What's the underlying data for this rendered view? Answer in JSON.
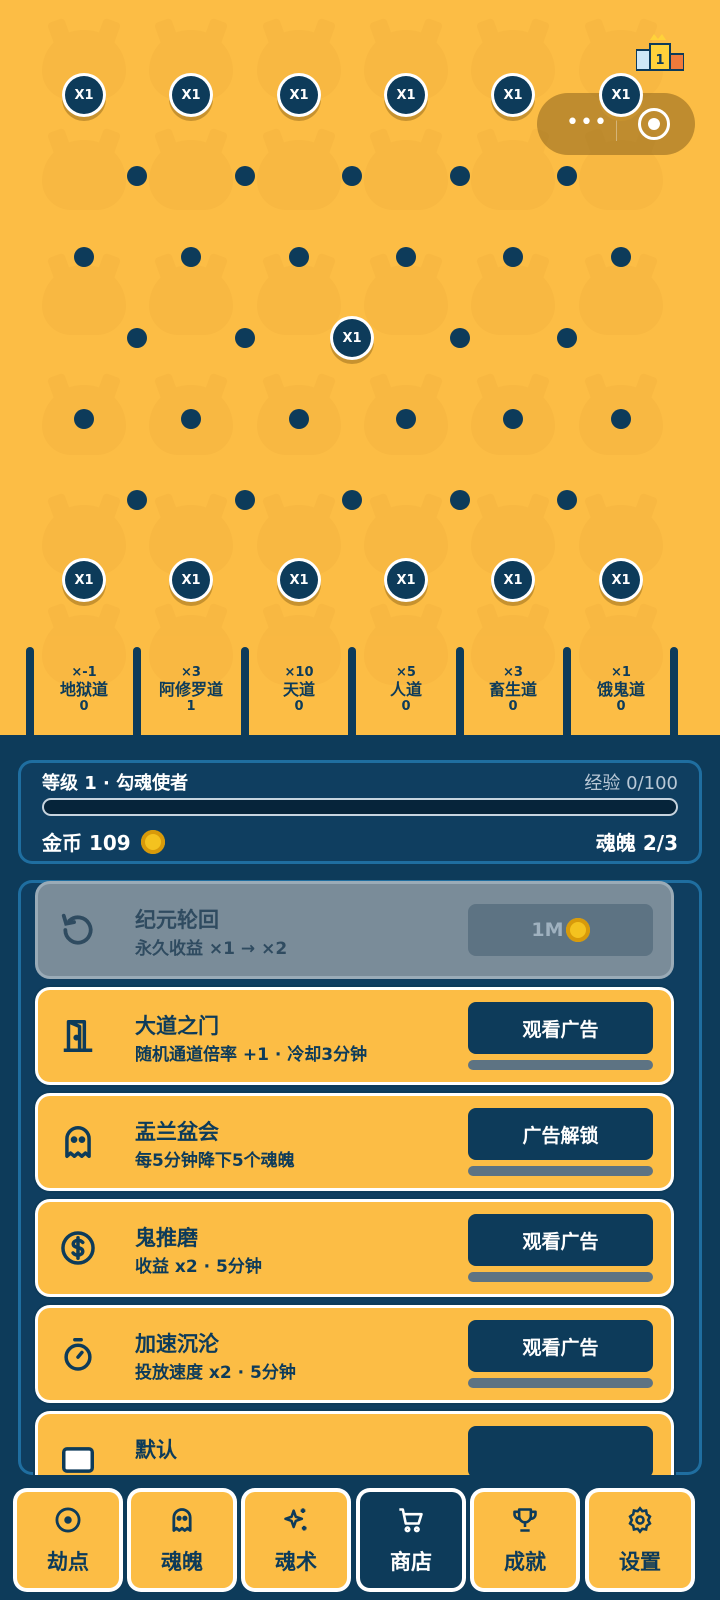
{
  "board": {
    "multiplier_label": "X1",
    "slots": [
      {
        "mult": "×-1",
        "name": "地狱道",
        "count": "0"
      },
      {
        "mult": "×3",
        "name": "阿修罗道",
        "count": "1"
      },
      {
        "mult": "×10",
        "name": "天道",
        "count": "0"
      },
      {
        "mult": "×5",
        "name": "人道",
        "count": "0"
      },
      {
        "mult": "×3",
        "name": "畜生道",
        "count": "0"
      },
      {
        "mult": "×1",
        "name": "饿鬼道",
        "count": "0"
      }
    ],
    "trophy_rank": "1"
  },
  "mini_capsule": {
    "more_glyph": "•••"
  },
  "status": {
    "level": "等级 1 · 勾魂使者",
    "exp": "经验 0/100",
    "exp_fraction": 0,
    "gold_label": "金币 109",
    "souls_label": "魂魄 2/3"
  },
  "shop": {
    "items": [
      {
        "title": "纪元轮回",
        "desc": "永久收益 ×1 → ×2",
        "button": "1M",
        "icon": "rotate-icon",
        "disabled": true
      },
      {
        "title": "大道之门",
        "desc": "随机通道倍率 +1 · 冷却3分钟",
        "button": "观看广告",
        "icon": "door-icon",
        "progress": 0
      },
      {
        "title": "盂兰盆会",
        "desc": "每5分钟降下5个魂魄",
        "button": "广告解锁",
        "icon": "ghost-icon",
        "progress": 0
      },
      {
        "title": "鬼推磨",
        "desc": "收益 x2 · 5分钟",
        "button": "观看广告",
        "icon": "dollar-icon",
        "progress": 0
      },
      {
        "title": "加速沉沦",
        "desc": "投放速度 x2 · 5分钟",
        "button": "观看广告",
        "icon": "timer-icon",
        "progress": 0
      },
      {
        "title": "默认",
        "desc": "",
        "button": "",
        "icon": "card-icon",
        "progress": 0
      }
    ]
  },
  "tabs": [
    {
      "label": "劫点",
      "icon": "target-icon"
    },
    {
      "label": "魂魄",
      "icon": "ghost-icon"
    },
    {
      "label": "魂术",
      "icon": "sparkle-icon"
    },
    {
      "label": "商店",
      "icon": "cart-icon",
      "active": true
    },
    {
      "label": "成就",
      "icon": "trophy-icon"
    },
    {
      "label": "设置",
      "icon": "gear-icon"
    }
  ],
  "colors": {
    "accent": "#fcbd45",
    "navy": "#0d3b5a",
    "disabled": "#7a8c99"
  }
}
